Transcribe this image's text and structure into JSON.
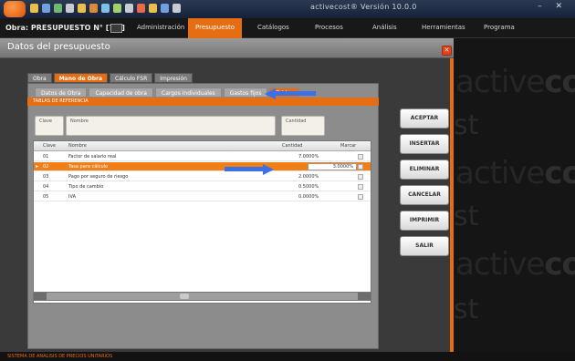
{
  "window": {
    "title": "activecost® Versión 10.0.0",
    "controls": "–  ✕"
  },
  "menubar": {
    "module_label": "Obra: PRESUPUESTO N° [???]",
    "items": [
      {
        "label": "Administración",
        "active": false
      },
      {
        "label": "Presupuesto",
        "active": true
      },
      {
        "label": "Catálogos",
        "active": false
      },
      {
        "label": "Procesos",
        "active": false
      },
      {
        "label": "Análisis",
        "active": false
      },
      {
        "label": "Herramientas",
        "active": false
      },
      {
        "label": "Programa",
        "active": false
      }
    ]
  },
  "dialog": {
    "title": "Datos del presupuesto",
    "close_glyph": "✕"
  },
  "outer_tabs": [
    {
      "label": "Obra",
      "active": false
    },
    {
      "label": "Mano de Obra",
      "active": true
    },
    {
      "label": "Cálculo FSR",
      "active": false
    },
    {
      "label": "Impresión",
      "active": false
    }
  ],
  "inner_tabs": [
    {
      "label": "Datos de Obra",
      "active": false
    },
    {
      "label": "Capacidad de obra",
      "active": false
    },
    {
      "label": "Cargos individuales",
      "active": false
    },
    {
      "label": "Gastos fijos",
      "active": false
    },
    {
      "label": "Tablas",
      "active": true
    }
  ],
  "section_label": "TABLAS DE REFERENCIA",
  "form": {
    "clave_label": "Clave",
    "nombre_label": "Nombre",
    "cantidad_label": "Cantidad"
  },
  "grid": {
    "columns": [
      "Clave",
      "Nombre",
      "Cantidad",
      "Marcar"
    ],
    "rows": [
      {
        "clave": "01",
        "nombre": "Factor de salario real",
        "cantidad": "7.0000%",
        "selected": false
      },
      {
        "clave": "02",
        "nombre": "Tasa para cálculo",
        "cantidad": "3.0000%",
        "selected": true
      },
      {
        "clave": "03",
        "nombre": "Pago por seguro de riesgo",
        "cantidad": "2.0000%",
        "selected": false
      },
      {
        "clave": "04",
        "nombre": "Tipo de cambio",
        "cantidad": "0.5000%",
        "selected": false
      },
      {
        "clave": "05",
        "nombre": "IVA",
        "cantidad": "0.0000%",
        "selected": false
      }
    ],
    "scroll_glyph": "III"
  },
  "actions": [
    "ACEPTAR",
    "INSERTAR",
    "ELIMINAR",
    "CANCELAR",
    "IMPRIMIR",
    "SALIR"
  ],
  "brand": {
    "word_prefix": "active",
    "word_suffix": "cost",
    "fragment": "st"
  },
  "status": {
    "text": "SISTEMA DE ANALISIS DE PRECIOS UNITARIOS"
  },
  "colors": {
    "accent_orange": "#e66d12",
    "annotation_blue": "#3d6fe6"
  }
}
